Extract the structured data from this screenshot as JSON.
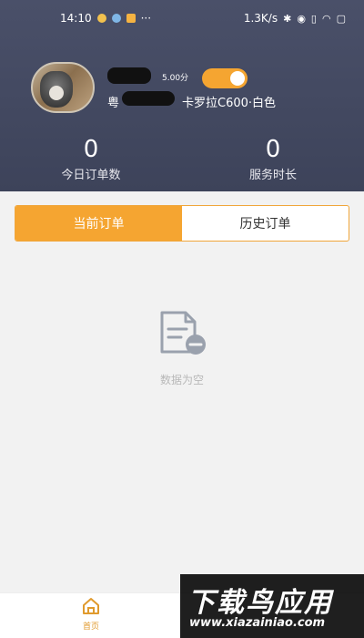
{
  "status_bar": {
    "time": "14:10",
    "dots": "···",
    "network_speed": "1.3K/s"
  },
  "profile": {
    "rating": "5.00分",
    "plate_prefix": "粤",
    "car_model": "卡罗拉C600·白色",
    "toggle_on": true
  },
  "stats": {
    "today_orders": {
      "value": "0",
      "label": "今日订单数"
    },
    "service_time": {
      "value": "0",
      "label": "服务时长"
    }
  },
  "tabs": [
    {
      "label": "当前订单",
      "active": true
    },
    {
      "label": "历史订单",
      "active": false
    }
  ],
  "empty_state": {
    "text": "数据为空",
    "icon": "empty-document-icon"
  },
  "bottom_nav": {
    "home_label": "首页",
    "home_icon": "home-icon"
  },
  "watermark": {
    "title": "下载鸟应用",
    "url": "www.xiazainiao.com"
  },
  "colors": {
    "accent": "#f5a531",
    "header_bg": "#474c64"
  }
}
